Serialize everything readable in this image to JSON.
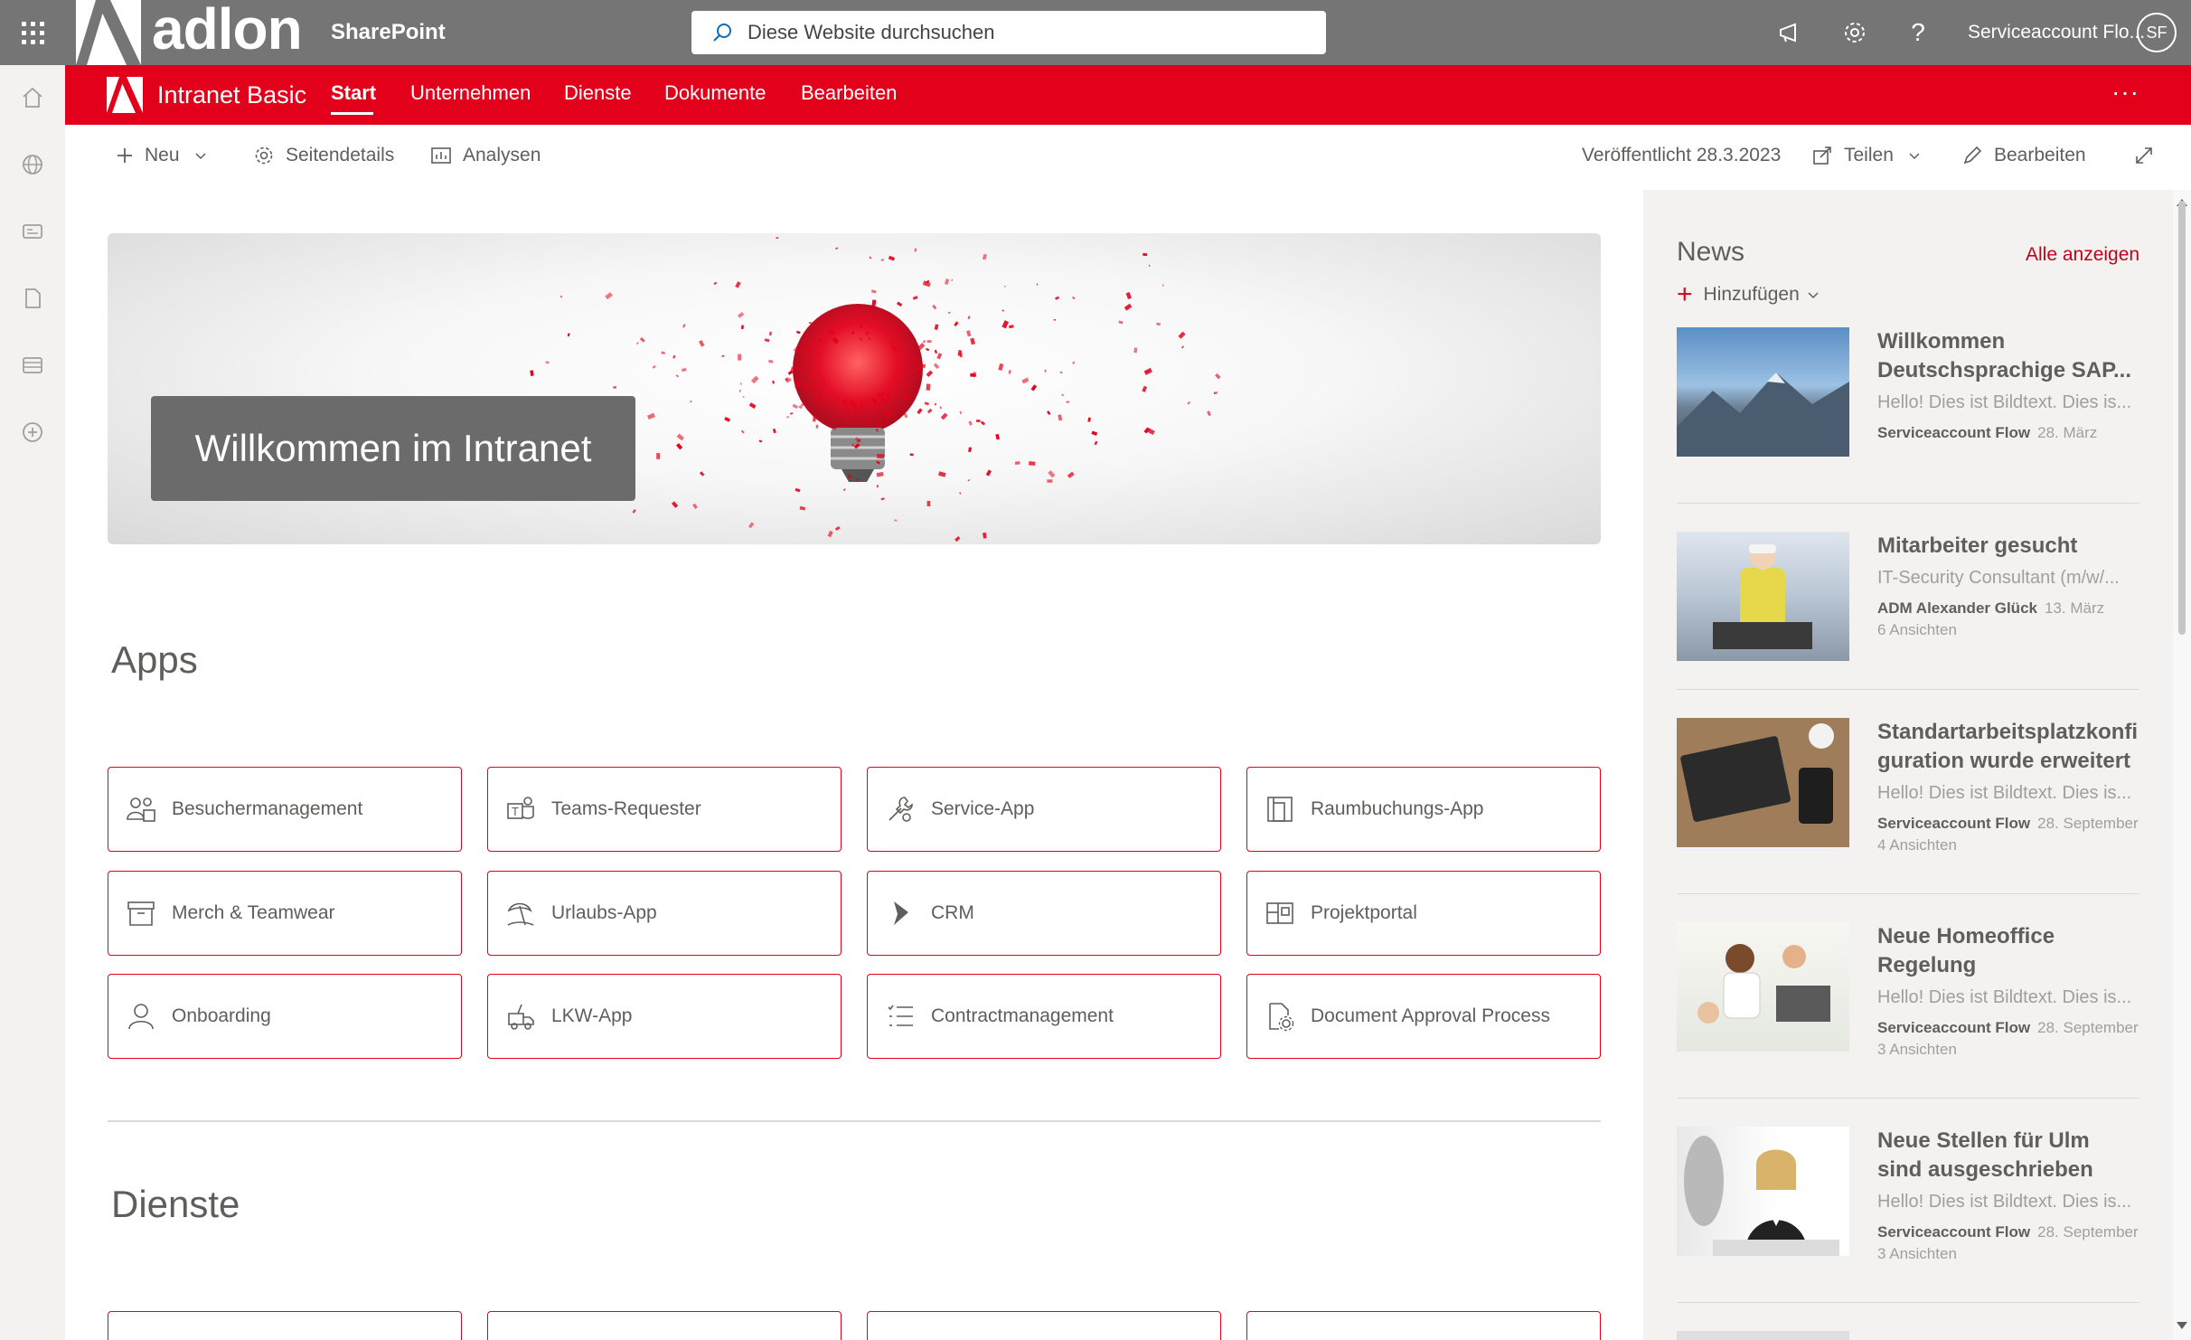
{
  "suite": {
    "brand": "adlon",
    "app_name": "SharePoint",
    "search_placeholder": "Diese Website durchsuchen",
    "user_name": "Serviceaccount Flo...",
    "user_initials": "SF"
  },
  "site": {
    "title": "Intranet Basic",
    "nav": [
      "Start",
      "Unternehmen",
      "Dienste",
      "Dokumente",
      "Bearbeiten"
    ],
    "active_nav": "Start",
    "more": "···"
  },
  "command_bar": {
    "new": "Neu",
    "page_details": "Seitendetails",
    "analytics": "Analysen",
    "published": "Veröffentlicht 28.3.2023",
    "share": "Teilen",
    "edit": "Bearbeiten"
  },
  "hero": {
    "title": "Willkommen im Intranet"
  },
  "sections": {
    "apps": "Apps",
    "services": "Dienste"
  },
  "apps": [
    {
      "label": "Besuchermanagement",
      "icon": "visitors-icon"
    },
    {
      "label": "Teams-Requester",
      "icon": "teams-icon"
    },
    {
      "label": "Service-App",
      "icon": "wrench-icon"
    },
    {
      "label": "Raumbuchungs-App",
      "icon": "room-icon"
    },
    {
      "label": "Merch & Teamwear",
      "icon": "box-icon"
    },
    {
      "label": "Urlaubs-App",
      "icon": "beach-icon"
    },
    {
      "label": "CRM",
      "icon": "dynamics-icon"
    },
    {
      "label": "Projektportal",
      "icon": "blueprint-icon"
    },
    {
      "label": "Onboarding",
      "icon": "person-icon"
    },
    {
      "label": "LKW-App",
      "icon": "truck-icon"
    },
    {
      "label": "Contractmanagement",
      "icon": "list-icon"
    },
    {
      "label": "Document Approval Process",
      "icon": "document-settings-icon"
    }
  ],
  "news": {
    "title": "News",
    "see_all": "Alle anzeigen",
    "add": "Hinzufügen",
    "items": [
      {
        "title": "Willkommen Deutschsprachige SAP...",
        "subtitle": "Hello! Dies ist Bildtext. Dies is...",
        "author": "Serviceaccount Flow",
        "date": "28. März",
        "views": ""
      },
      {
        "title": "Mitarbeiter gesucht",
        "subtitle": "IT-Security Consultant (m/w/...",
        "author": "ADM Alexander Glück",
        "date": "13. März",
        "views": "6 Ansichten"
      },
      {
        "title": "Standartarbeitsplatzkonfiguration wurde erweitert",
        "subtitle": "Hello! Dies ist Bildtext. Dies is...",
        "author": "Serviceaccount Flow",
        "date": "28. September",
        "views": "4 Ansichten"
      },
      {
        "title": "Neue Homeoffice Regelung",
        "subtitle": "Hello! Dies ist Bildtext. Dies is...",
        "author": "Serviceaccount Flow",
        "date": "28. September",
        "views": "3 Ansichten"
      },
      {
        "title": "Neue Stellen für Ulm sind ausgeschrieben",
        "subtitle": "Hello! Dies ist Bildtext. Dies is...",
        "author": "Serviceaccount Flow",
        "date": "28. September",
        "views": "3 Ansichten"
      }
    ]
  },
  "colors": {
    "suitebar": "#757575",
    "brand_red": "#e2001a",
    "text": "#605e5c"
  }
}
